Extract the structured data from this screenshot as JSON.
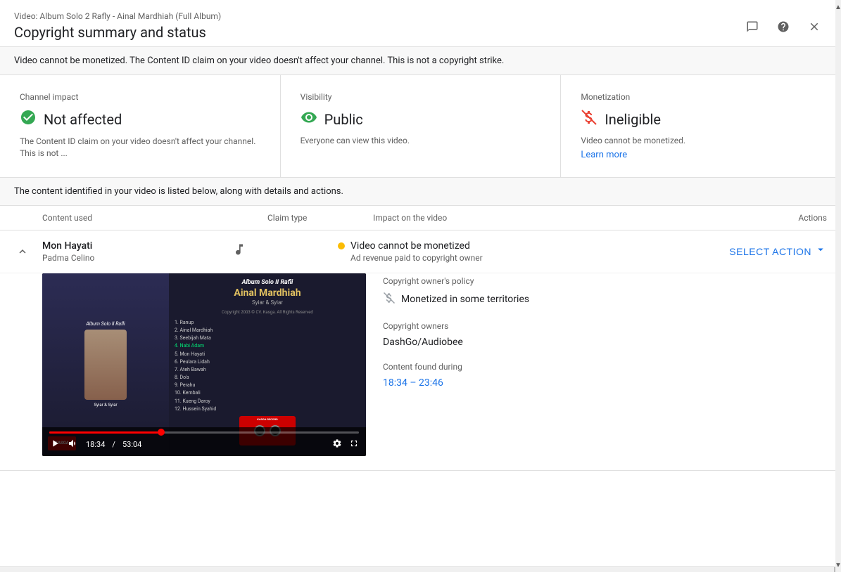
{
  "dialog": {
    "subtitle": "Video: Album Solo 2 Rafly - Ainal Mardhiah (Full Album)",
    "title": "Copyright summary and status",
    "close_label": "×",
    "help_label": "?",
    "feedback_label": "⚑"
  },
  "info_banner": {
    "text": "Video cannot be monetized. The Content ID claim on your video doesn't affect your channel. This is not a copyright strike."
  },
  "status_cards": [
    {
      "label": "Channel impact",
      "value": "Not affected",
      "icon": "check-circle-icon",
      "desc": "The Content ID claim on your video doesn't affect your channel. This is not ..."
    },
    {
      "label": "Visibility",
      "value": "Public",
      "icon": "eye-icon",
      "desc": "Everyone can view this video."
    },
    {
      "label": "Monetization",
      "value": "Ineligible",
      "icon": "no-dollar-icon",
      "desc": "Video cannot be monetized.",
      "learn_more": "Learn more"
    }
  ],
  "content_banner": {
    "text": "The content identified in your video is listed below, along with details and actions."
  },
  "table": {
    "headers": {
      "content": "Content used",
      "claim_type": "Claim type",
      "impact": "Impact on the video",
      "actions": "Actions"
    },
    "rows": [
      {
        "title": "Mon Hayati",
        "subtitle": "Padma Celino",
        "claim_type_icon": "music-note-icon",
        "impact_text": "Video cannot be monetized",
        "impact_sub": "Ad revenue paid to copyright owner",
        "action_label": "SELECT ACTION",
        "impact_dot_color": "#fbbc04",
        "expanded": true,
        "details": {
          "policy_label": "Copyright owner's policy",
          "policy_icon": "no-dollar-icon",
          "policy_value": "Monetized in some territories",
          "owners_label": "Copyright owners",
          "owners_value": "DashGo/Audiobee",
          "found_label": "Content found during",
          "found_time": "18:34 – 23:46"
        }
      }
    ]
  },
  "video": {
    "album_title": "Album Solo II Rafli",
    "artist_name": "Ainal Mardhiah",
    "album_sub": "Syiar & Syiar",
    "copyright": "Copyright 2003 © CV. Kasga. All Rights Reserved",
    "tracklist": [
      "1. Ranup",
      "2. Ainal Mardhiah",
      "3. Seebijah Mata",
      "4. Nabi Adam",
      "5. Mon Hayati",
      "6. Peulara Lidah",
      "7. Ateh Bawah",
      "8. Do'a",
      "9. Perahu",
      "10. Kembali",
      "11. Kueng Daroy",
      "12. Hussein Syahid"
    ],
    "highlighted_track": 4,
    "current_time": "18:34",
    "total_time": "53:04",
    "progress_percent": 35,
    "label_brand": "KASGA RECORD"
  }
}
